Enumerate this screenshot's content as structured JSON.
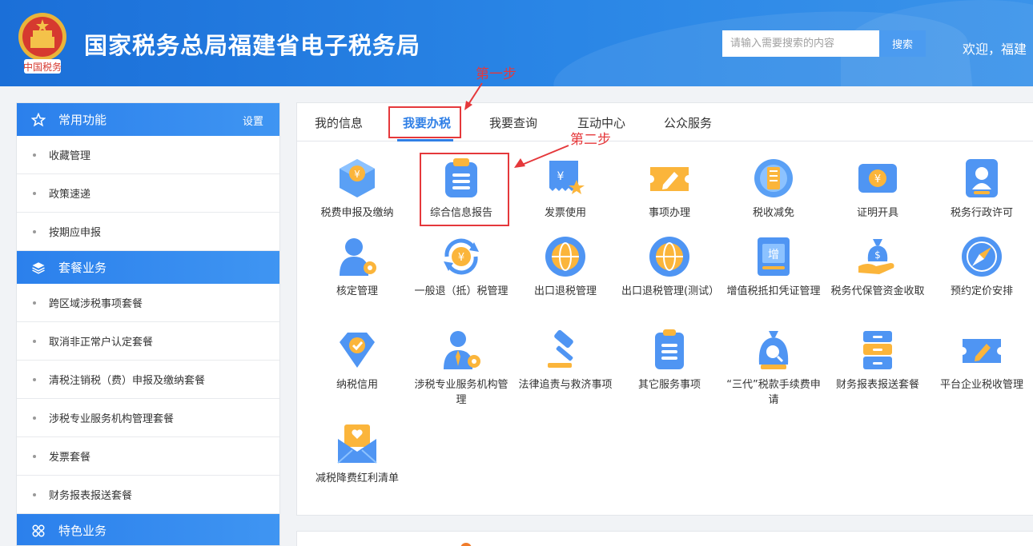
{
  "header": {
    "title": "国家税务总局福建省电子税务局",
    "search_placeholder": "请输入需要搜索的内容",
    "search_button": "搜索",
    "welcome": "欢迎，福建",
    "emblem_text": "中国税务",
    "colors": {
      "bg": "#1b6fd8",
      "accent": "#4b9bf0"
    }
  },
  "sidebar": {
    "sections": [
      {
        "title": "常用功能",
        "icon": "star-icon",
        "action": "设置",
        "items": [
          "收藏管理",
          "政策速递",
          "按期应申报"
        ]
      },
      {
        "title": "套餐业务",
        "icon": "layers-icon",
        "items": [
          "跨区域涉税事项套餐",
          "取消非正常户认定套餐",
          "清税注销税（费）申报及缴纳套餐",
          "涉税专业服务机构管理套餐",
          "发票套餐",
          "财务报表报送套餐"
        ]
      },
      {
        "title": "特色业务",
        "icon": "grid-icon",
        "items": []
      }
    ]
  },
  "tabs": [
    "我的信息",
    "我要办税",
    "我要查询",
    "互动中心",
    "公众服务"
  ],
  "active_tab": "我要办税",
  "services": [
    {
      "label": "税费申报及缴纳",
      "icon": "tax-declare-icon"
    },
    {
      "label": "综合信息报告",
      "icon": "clipboard-icon"
    },
    {
      "label": "发票使用",
      "icon": "invoice-icon"
    },
    {
      "label": "事项办理",
      "icon": "edit-ticket-icon"
    },
    {
      "label": "税收减免",
      "icon": "tax-relief-icon"
    },
    {
      "label": "证明开具",
      "icon": "certificate-icon"
    },
    {
      "label": "税务行政许可",
      "icon": "admin-license-icon"
    },
    {
      "label": "核定管理",
      "icon": "user-gear-icon"
    },
    {
      "label": "一般退（抵）税管理",
      "icon": "refund-icon"
    },
    {
      "label": "出口退税管理",
      "icon": "globe-icon"
    },
    {
      "label": "出口退税管理(测试）",
      "icon": "globe-icon"
    },
    {
      "label": "增值税抵扣凭证管理",
      "icon": "vat-ticket-icon"
    },
    {
      "label": "税务代保管资金收取",
      "icon": "money-bag-icon"
    },
    {
      "label": "预约定价安排",
      "icon": "compass-icon"
    },
    {
      "label": "纳税信用",
      "icon": "diamond-check-icon"
    },
    {
      "label": "涉税专业服务机构管理",
      "icon": "agent-gear-icon"
    },
    {
      "label": "法律追责与救济事项",
      "icon": "gavel-icon"
    },
    {
      "label": "其它服务事项",
      "icon": "list-doc-icon"
    },
    {
      "label": "“三代”税款手续费申请",
      "icon": "search-bag-icon"
    },
    {
      "label": "财务报表报送套餐",
      "icon": "cabinet-icon"
    },
    {
      "label": "平台企业税收管理",
      "icon": "edit-ticket-icon"
    },
    {
      "label": "减税降费红利清单",
      "icon": "envelope-heart-icon"
    }
  ],
  "annotations": {
    "step1": "第一步",
    "step2": "第二步"
  }
}
